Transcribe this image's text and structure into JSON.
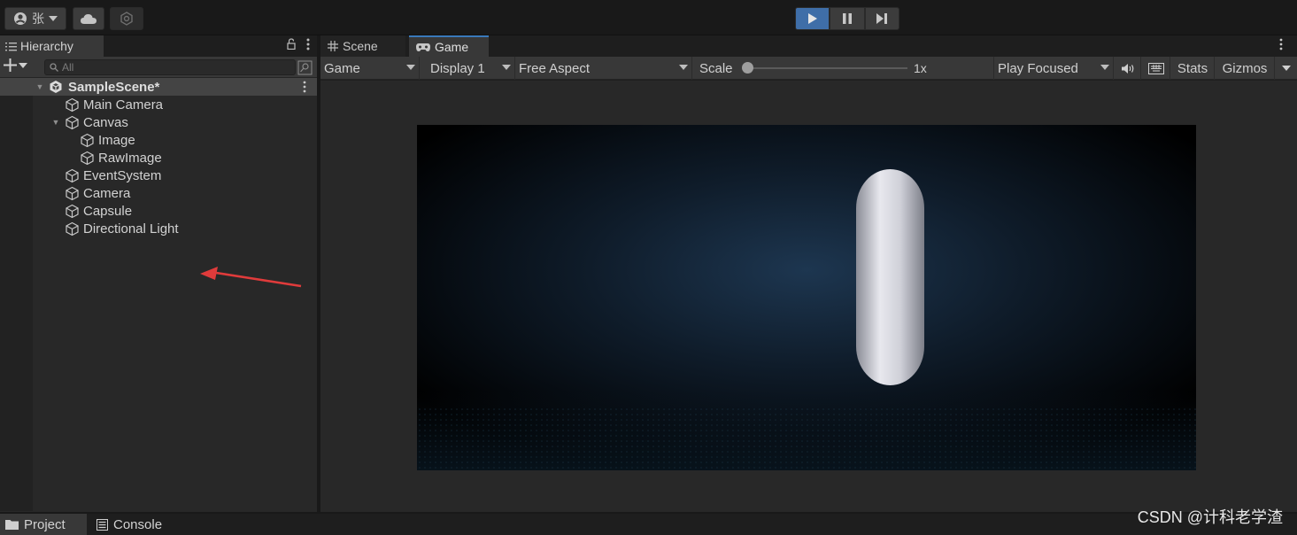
{
  "toolbar": {
    "account_name": "张",
    "icons": [
      "account-icon",
      "cloud-icon",
      "collab-icon",
      "play-icon",
      "pause-icon",
      "step-icon"
    ]
  },
  "hierarchy": {
    "tab_label": "Hierarchy",
    "search_placeholder": "All",
    "scene_name": "SampleScene*",
    "items": [
      {
        "label": "Main Camera"
      },
      {
        "label": "Canvas"
      },
      {
        "label": "Image"
      },
      {
        "label": "RawImage"
      },
      {
        "label": "EventSystem"
      },
      {
        "label": "Camera"
      },
      {
        "label": "Capsule"
      },
      {
        "label": "Directional Light"
      }
    ]
  },
  "game": {
    "tabs": {
      "scene": "Scene",
      "game": "Game"
    },
    "toolbar": {
      "view_mode": "Game",
      "display": "Display 1",
      "aspect": "Free Aspect",
      "scale_label": "Scale",
      "scale_value": "1x",
      "play_mode": "Play Focused",
      "stats": "Stats",
      "gizmos": "Gizmos"
    }
  },
  "bottom": {
    "project_tab": "Project",
    "console_tab": "Console"
  },
  "watermark": "CSDN @计科老学渣",
  "colors": {
    "accent": "#3a79bb",
    "play_active": "#3f6ea8",
    "annotation_arrow": "#e03b3b"
  }
}
